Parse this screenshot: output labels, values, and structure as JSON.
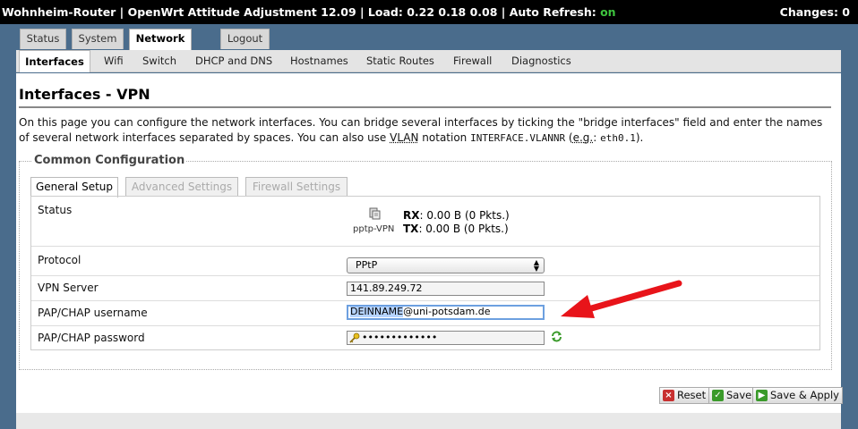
{
  "topbar": {
    "title": "Wohnheim-Router | OpenWrt Attitude Adjustment 12.09 | Load: 0.22 0.18 0.08 | Auto Refresh: ",
    "auto_refresh": "on",
    "changes": "Changes: 0"
  },
  "main_tabs": [
    {
      "label": "Status",
      "active": false
    },
    {
      "label": "System",
      "active": false
    },
    {
      "label": "Network",
      "active": true
    },
    {
      "label": "Logout",
      "active": false
    }
  ],
  "sub_tabs": [
    {
      "label": "Interfaces",
      "active": true
    },
    {
      "label": "Wifi",
      "active": false
    },
    {
      "label": "Switch",
      "active": false
    },
    {
      "label": "DHCP and DNS",
      "active": false
    },
    {
      "label": "Hostnames",
      "active": false
    },
    {
      "label": "Static Routes",
      "active": false
    },
    {
      "label": "Firewall",
      "active": false
    },
    {
      "label": "Diagnostics",
      "active": false
    }
  ],
  "page": {
    "title": "Interfaces - VPN",
    "desc_part1": "On this page you can configure the network interfaces. You can bridge several interfaces by ticking the \"bridge interfaces\" field and enter the names of several network interfaces separated by spaces. You can also use ",
    "desc_vlan": "VLAN",
    "desc_part2": " notation ",
    "desc_code1": "INTERFACE.VLANNR",
    "desc_part3": " (",
    "desc_eg": "e.g.",
    "desc_part4": ": ",
    "desc_code2": "eth0.1",
    "desc_part5": ")."
  },
  "common": {
    "legend": "Common Configuration",
    "tabs": [
      {
        "label": "General Setup",
        "active": true
      },
      {
        "label": "Advanced Settings",
        "active": false
      },
      {
        "label": "Firewall Settings",
        "active": false
      }
    ]
  },
  "form": {
    "status_label": "Status",
    "iface_name": "pptp-VPN",
    "rx_label": "RX",
    "rx_value": ": 0.00 B (0 Pkts.)",
    "tx_label": "TX",
    "tx_value": ": 0.00 B (0 Pkts.)",
    "protocol_label": "Protocol",
    "protocol_value": "PPtP",
    "vpn_server_label": "VPN Server",
    "vpn_server_value": "141.89.249.72",
    "username_label": "PAP/CHAP username",
    "username_selected": "DEINNAME",
    "username_rest": "@uni-potsdam.de",
    "password_label": "PAP/CHAP password",
    "password_value": "•••••••••••••"
  },
  "buttons": {
    "reset": "Reset",
    "save": "Save",
    "save_apply": "Save & Apply"
  },
  "colors": {
    "background": "#4a6c8c",
    "topbar": "#000000",
    "auto_refresh_on": "#3ec43e",
    "annotation_arrow": "#e8141a"
  },
  "icons": [
    "network-interface-icon",
    "key-icon",
    "reveal-password-icon",
    "reset-icon",
    "save-icon",
    "save-apply-icon",
    "annotation-arrow"
  ]
}
